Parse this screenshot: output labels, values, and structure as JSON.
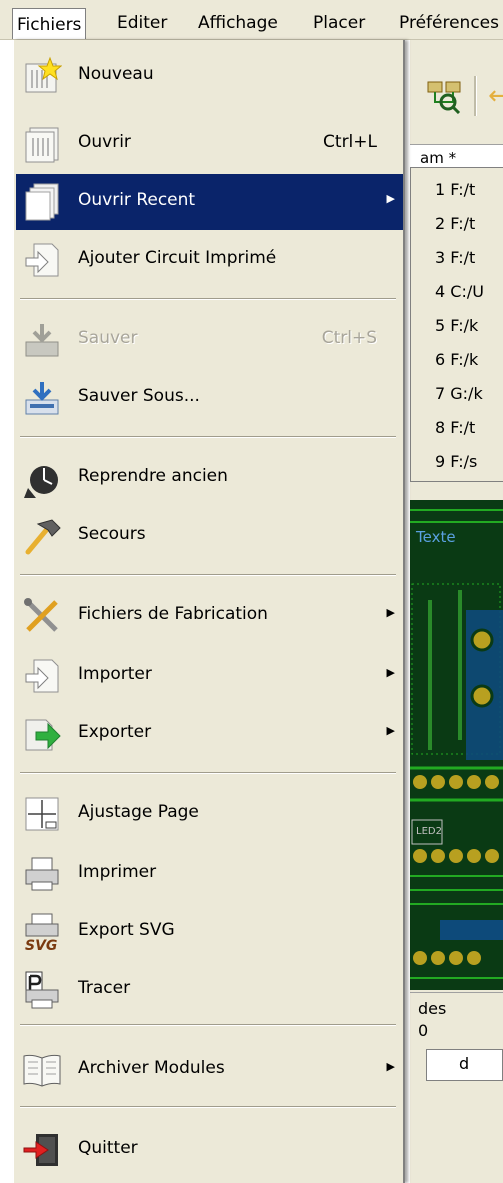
{
  "menubar": {
    "items": [
      {
        "label": "Fichiers",
        "active": true
      },
      {
        "label": "Editer"
      },
      {
        "label": "Affichage"
      },
      {
        "label": "Placer"
      },
      {
        "label": "Préférences"
      }
    ]
  },
  "background": {
    "tab_label": "am *",
    "pcb_text": "Texte",
    "pcb_label": "LED2",
    "status_line1": "des",
    "status_line2": "0",
    "status_box": "d"
  },
  "menu": {
    "items": [
      {
        "label": "Nouveau",
        "icon": "new-board-icon"
      },
      {
        "label": "Ouvrir",
        "shortcut": "Ctrl+L",
        "icon": "open-board-icon"
      },
      {
        "label": "Ouvrir Recent",
        "submenu": true,
        "highlighted": true,
        "icon": "recent-files-icon"
      },
      {
        "label": "Ajouter Circuit Imprimé",
        "icon": "append-board-icon"
      },
      {
        "label": "Sauver",
        "shortcut": "Ctrl+S",
        "disabled": true,
        "icon": "save-icon"
      },
      {
        "label": "Sauver Sous...",
        "icon": "save-as-icon"
      },
      {
        "label": "Reprendre ancien",
        "icon": "revert-icon"
      },
      {
        "label": "Secours",
        "icon": "rescue-hammer-icon"
      },
      {
        "label": "Fichiers de Fabrication",
        "submenu": true,
        "icon": "fabrication-tools-icon"
      },
      {
        "label": "Importer",
        "submenu": true,
        "icon": "import-icon"
      },
      {
        "label": "Exporter",
        "submenu": true,
        "icon": "export-icon"
      },
      {
        "label": "Ajustage Page",
        "icon": "page-settings-icon"
      },
      {
        "label": "Imprimer",
        "icon": "printer-icon"
      },
      {
        "label": "Export SVG",
        "icon": "svg-export-icon",
        "icon_text": "SVG"
      },
      {
        "label": "Tracer",
        "icon": "plotter-icon"
      },
      {
        "label": "Archiver Modules",
        "submenu": true,
        "icon": "archive-book-icon"
      },
      {
        "label": "Quitter",
        "icon": "exit-door-icon"
      }
    ]
  },
  "recent_files": [
    {
      "label": "1 F:/t"
    },
    {
      "label": "2 F:/t"
    },
    {
      "label": "3 F:/t"
    },
    {
      "label": "4 C:/U"
    },
    {
      "label": "5 F:/k"
    },
    {
      "label": "6 F:/k"
    },
    {
      "label": "7 G:/k"
    },
    {
      "label": "8 F:/t"
    },
    {
      "label": "9 F:/s"
    }
  ],
  "colors": {
    "menu_bg": "#ece9d8",
    "highlight": "#0a246a",
    "pcb_green": "#0a3a14",
    "track_green": "#22aa22",
    "pad_gold": "#b8a020"
  }
}
